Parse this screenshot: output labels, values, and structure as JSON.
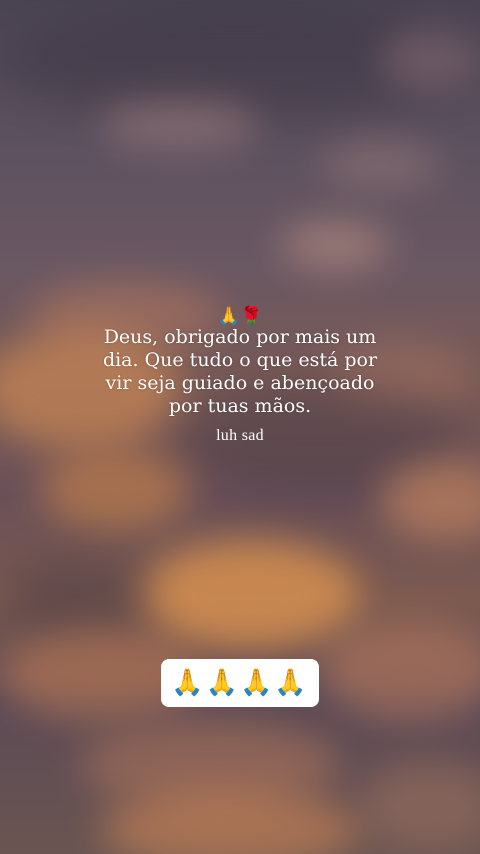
{
  "story": {
    "emoji_line": "🙏🌹",
    "caption": "Deus, obrigado por mais um dia. Que tudo o que está por vir seja guiado e abençoado por tuas mãos.",
    "username": "luh sad",
    "sticker_emojis": "🙏🙏🙏🙏"
  },
  "colors": {
    "text": "#ffffff",
    "sticker_bg": "#ffffff"
  },
  "icons": [
    "praying-hands-icon",
    "rose-icon"
  ]
}
